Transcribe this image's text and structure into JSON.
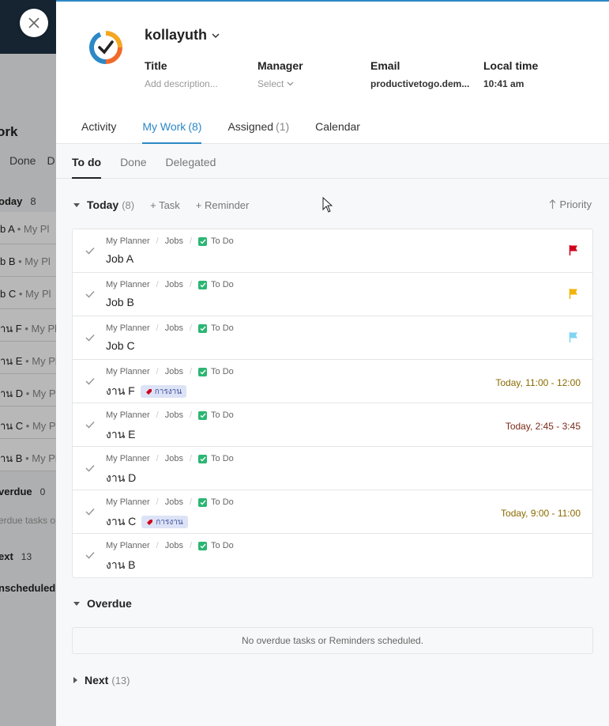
{
  "background": {
    "title": "ork",
    "tabs": [
      "Done",
      "D"
    ],
    "today_label": "oday",
    "today_count": "8",
    "rows": [
      {
        "a": "b A",
        "b": "My Pl"
      },
      {
        "a": "b B",
        "b": "My Pl"
      },
      {
        "a": "b C",
        "b": "My Pl"
      },
      {
        "a": "าน F",
        "b": "My Pl"
      },
      {
        "a": "าน E",
        "b": "My Pl"
      },
      {
        "a": "าน D",
        "b": "My Pl"
      },
      {
        "a": "าน C",
        "b": "My Pl"
      },
      {
        "a": "าน B",
        "b": "My Pl"
      }
    ],
    "overdue_label": "verdue",
    "overdue_count": "0",
    "overdue_msg": "erdue tasks o",
    "next_label": "ext",
    "next_count": "13",
    "unscheduled_label": "nscheduled"
  },
  "header": {
    "user_name": "kollayuth",
    "fields": [
      {
        "label": "Title",
        "value": "Add description..."
      },
      {
        "label": "Manager",
        "value": "Select"
      },
      {
        "label": "Email",
        "value": "productivetogo.dem..."
      },
      {
        "label": "Local time",
        "value": "10:41 am"
      }
    ]
  },
  "main_tabs": [
    {
      "label": "Activity",
      "count": ""
    },
    {
      "label": "My Work",
      "count": "(8)"
    },
    {
      "label": "Assigned",
      "count": "(1)"
    },
    {
      "label": "Calendar",
      "count": ""
    }
  ],
  "sub_tabs": [
    "To do",
    "Done",
    "Delegated"
  ],
  "today": {
    "title": "Today",
    "count": "(8)",
    "add_task": "+ Task",
    "add_reminder": "+ Reminder",
    "sort": "Priority"
  },
  "crumbs": {
    "planner": "My Planner",
    "bucket": "Jobs",
    "status": "To Do"
  },
  "tasks": [
    {
      "name": "Job A",
      "tag": "",
      "time": "",
      "flag_color": "#d0021b",
      "time_color": ""
    },
    {
      "name": "Job B",
      "tag": "",
      "time": "",
      "flag_color": "#f0b30a",
      "time_color": ""
    },
    {
      "name": "Job C",
      "tag": "",
      "time": "",
      "flag_color": "#7fd4f2",
      "time_color": ""
    },
    {
      "name": "งาน F",
      "tag": "การงาน",
      "time": "Today, 11:00 - 12:00",
      "flag_color": "",
      "time_color": "#8a6a00"
    },
    {
      "name": "งาน E",
      "tag": "",
      "time": "Today, 2:45 - 3:45",
      "flag_color": "",
      "time_color": "#7a2a18"
    },
    {
      "name": "งาน D",
      "tag": "",
      "time": "",
      "flag_color": "",
      "time_color": ""
    },
    {
      "name": "งาน C",
      "tag": "การงาน",
      "time": "Today, 9:00 - 11:00",
      "flag_color": "",
      "time_color": "#8a6a00"
    },
    {
      "name": "งาน B",
      "tag": "",
      "time": "",
      "flag_color": "",
      "time_color": ""
    }
  ],
  "overdue": {
    "title": "Overdue",
    "empty_msg": "No overdue tasks or Reminders scheduled."
  },
  "next": {
    "title": "Next",
    "count": "(13)"
  },
  "colors": {
    "accent": "#2c88c6",
    "status_green": "#2bb673"
  }
}
